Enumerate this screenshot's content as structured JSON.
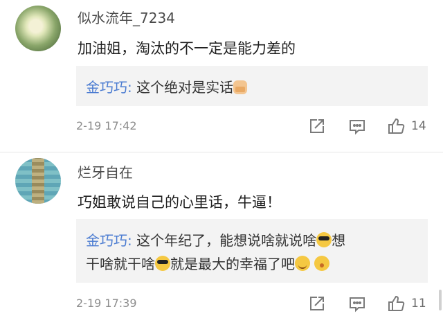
{
  "comments": [
    {
      "username": "似水流年_7234",
      "avatar_icon": "flower-avatar",
      "content": "加油姐，淘汰的不一定是能力差的",
      "reply": {
        "author": "金巧巧:",
        "text": " 这个绝对是实话",
        "emojis": [
          "thumbs-up-emoji"
        ]
      },
      "time": "2-19 17:42",
      "likes": "14"
    },
    {
      "username": "烂牙自在",
      "avatar_icon": "turtle-avatar",
      "content": "巧姐敢说自己的心里话，牛逼！",
      "reply": {
        "author": "金巧巧:",
        "text_part1": " 这个年纪了，能想说啥就说啥",
        "text_part2": "想",
        "text_part3": "干啥就干啥",
        "text_part4": "就是最大的幸福了吧"
      },
      "time": "2-19 17:39",
      "likes": "11"
    }
  ],
  "icons": {
    "share": "share-icon",
    "comment": "comment-icon",
    "like": "thumbs-up-icon"
  },
  "colors": {
    "author": "#4a7bd1",
    "reply_bg": "#f3f3f3",
    "muted": "#8c8c8c"
  }
}
